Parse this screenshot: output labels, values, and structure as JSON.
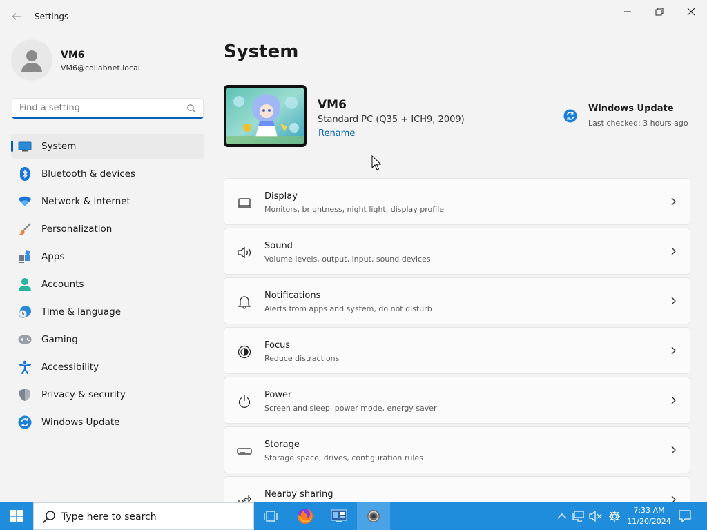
{
  "window": {
    "title": "Settings"
  },
  "profile": {
    "name": "VM6",
    "email": "VM6@collabnet.local"
  },
  "search": {
    "placeholder": "Find a setting"
  },
  "sidebar": {
    "items": [
      {
        "label": "System",
        "icon": "system-icon",
        "active": true
      },
      {
        "label": "Bluetooth & devices",
        "icon": "bluetooth-icon"
      },
      {
        "label": "Network & internet",
        "icon": "wifi-icon"
      },
      {
        "label": "Personalization",
        "icon": "brush-icon"
      },
      {
        "label": "Apps",
        "icon": "apps-icon"
      },
      {
        "label": "Accounts",
        "icon": "accounts-icon"
      },
      {
        "label": "Time & language",
        "icon": "clock-globe-icon"
      },
      {
        "label": "Gaming",
        "icon": "gamepad-icon"
      },
      {
        "label": "Accessibility",
        "icon": "accessibility-icon"
      },
      {
        "label": "Privacy & security",
        "icon": "shield-icon"
      },
      {
        "label": "Windows Update",
        "icon": "windows-update-icon"
      }
    ]
  },
  "main": {
    "title": "System",
    "device": {
      "name": "VM6",
      "model": "Standard PC (Q35 + ICH9, 2009)",
      "rename_label": "Rename"
    },
    "windows_update": {
      "title": "Windows Update",
      "status": "Last checked: 3 hours ago"
    },
    "cards": [
      {
        "title": "Display",
        "subtitle": "Monitors, brightness, night light, display profile",
        "icon": "monitor-icon"
      },
      {
        "title": "Sound",
        "subtitle": "Volume levels, output, input, sound devices",
        "icon": "speaker-icon"
      },
      {
        "title": "Notifications",
        "subtitle": "Alerts from apps and system, do not disturb",
        "icon": "bell-icon"
      },
      {
        "title": "Focus",
        "subtitle": "Reduce distractions",
        "icon": "focus-icon"
      },
      {
        "title": "Power",
        "subtitle": "Screen and sleep, power mode, energy saver",
        "icon": "power-icon"
      },
      {
        "title": "Storage",
        "subtitle": "Storage space, drives, configuration rules",
        "icon": "storage-icon"
      },
      {
        "title": "Nearby sharing",
        "subtitle": "",
        "icon": "share-icon"
      }
    ]
  },
  "taskbar": {
    "search_text": "Type here to search",
    "time": "7:33 AM",
    "date": "11/20/2024"
  },
  "colors": {
    "accent": "#005fb8",
    "taskbar": "#1f8ddc",
    "active_app": "#4aa3e6"
  }
}
